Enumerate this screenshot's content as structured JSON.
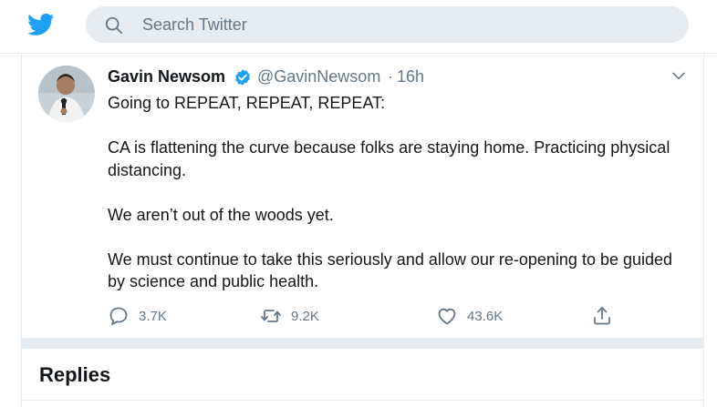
{
  "brand": {
    "logo_icon": "twitter-bird-icon",
    "color": "#1da1f2"
  },
  "search": {
    "placeholder": "Search Twitter",
    "icon": "search-icon"
  },
  "tweet": {
    "author_name": "Gavin Newsom",
    "verified": true,
    "handle": "@GavinNewsom",
    "separator": "·",
    "time": "16h",
    "paragraphs": [
      "Going to REPEAT, REPEAT, REPEAT:",
      "CA is flattening the curve because folks are staying home. Practicing physical distancing.",
      "We aren’t out of the woods yet.",
      "We must continue to take this seriously and allow our re-opening to be guided by science and public health."
    ],
    "actions": {
      "reply_count": "3.7K",
      "retweet_count": "9.2K",
      "like_count": "43.6K"
    }
  },
  "replies": {
    "title": "Replies"
  },
  "colors": {
    "secondary_text": "#657786",
    "border": "#e6ecf0",
    "accent": "#1da1f2"
  }
}
